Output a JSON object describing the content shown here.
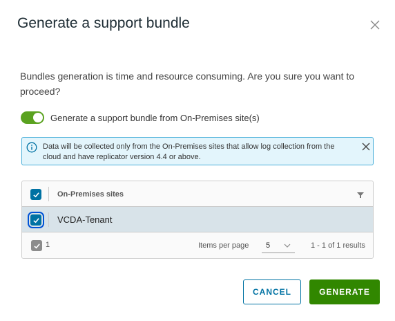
{
  "dialog": {
    "title": "Generate a support bundle",
    "close_icon": "close-icon"
  },
  "prompt_text": "Bundles generation is time and resource consuming. Are you sure you want to proceed?",
  "toggle": {
    "label": "Generate a support bundle from On-Premises site(s)",
    "checked": true,
    "color": "#5aa220"
  },
  "alert": {
    "icon": "info-icon",
    "text": "Data will be collected only from the On-Premises sites that allow log collection from the cloud and have replicator version 4.4 or above.",
    "close_icon": "close-icon"
  },
  "grid": {
    "column_header": "On-Premises sites",
    "filter_icon": "filter-icon",
    "select_all_checked": true,
    "rows": [
      {
        "name": "VCDA-Tenant",
        "selected": true
      }
    ],
    "footer": {
      "selected_count": "1",
      "items_per_page_label": "Items per page",
      "items_per_page_value": "5",
      "page_info": "1 - 1 of 1 results"
    }
  },
  "buttons": {
    "cancel": "CANCEL",
    "generate": "GENERATE"
  },
  "colors": {
    "primary": "#0072a3",
    "success": "#318700",
    "selected_row": "#d8e3e9",
    "alert_bg": "#e3f5fc",
    "alert_border": "#49afd9"
  }
}
